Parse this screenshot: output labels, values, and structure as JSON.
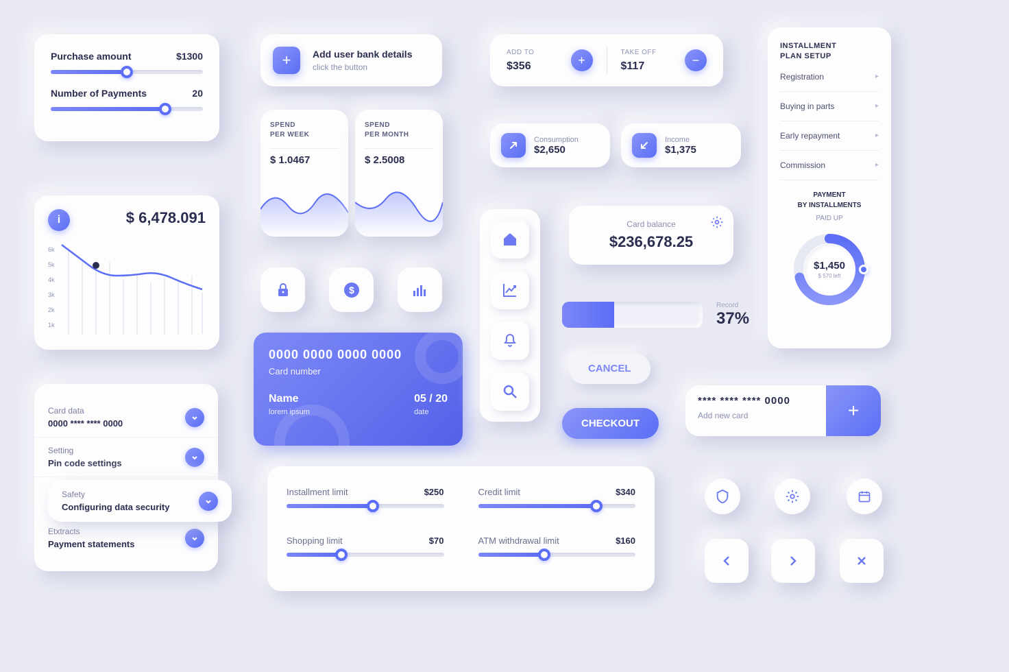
{
  "purchase": {
    "amount_label": "Purchase amount",
    "amount": "$1300",
    "payments_label": "Number of Payments",
    "payments": "20"
  },
  "bank": {
    "title": "Add user bank details",
    "subtitle": "click the button"
  },
  "addtake": {
    "add_label": "ADD TO",
    "add_value": "$356",
    "take_label": "TAKE OFF",
    "take_value": "$117"
  },
  "spend_week": {
    "label": "SPEND\nPER WEEK",
    "value": "$ 1.0467"
  },
  "spend_month": {
    "label": "SPEND\nPER MONTH",
    "value": "$ 2.5008"
  },
  "consumption": {
    "label": "Consumption",
    "value": "$2,650"
  },
  "income": {
    "label": "Income",
    "value": "$1,375"
  },
  "balance_chart": {
    "amount": "$ 6,478.091"
  },
  "card_balance": {
    "label": "Card balance",
    "value": "$236,678.25"
  },
  "progress": {
    "record_label": "Record",
    "record_value": "37%"
  },
  "buttons": {
    "cancel": "CANCEL",
    "checkout": "CHECKOUT"
  },
  "newcard": {
    "number": "**** **** **** 0000",
    "label": "Add new card"
  },
  "credit": {
    "number": "0000 0000 0000 0000",
    "number_label": "Card number",
    "name_label": "Name",
    "name_value": "lorem ipsum",
    "date_label": "date",
    "date_value": "05 / 20"
  },
  "settings": [
    {
      "title": "Card data",
      "value": "0000 **** **** 0000"
    },
    {
      "title": "Setting",
      "value": "Pin code settings"
    },
    {
      "title": "Safety",
      "value": "Configuring data security"
    },
    {
      "title": "Etxtracts",
      "value": "Payment statements"
    }
  ],
  "limits": {
    "installment": {
      "label": "Installment limit",
      "value": "$250"
    },
    "credit": {
      "label": "Credit limit",
      "value": "$340"
    },
    "shopping": {
      "label": "Shopping limit",
      "value": "$70"
    },
    "atm": {
      "label": "ATM withdrawal limit",
      "value": "$160"
    }
  },
  "installment": {
    "title": "INSTALLMENT\nPLAN SETUP",
    "items": [
      "Registration",
      "Buying in parts",
      "Early repayment",
      "Commission"
    ],
    "pay_title": "PAYMENT\nBY INSTALLMENTS",
    "paid": "PAID UP",
    "donut_value": "$1,450",
    "donut_sub": "$ 570 left"
  },
  "chart_data": {
    "type": "line",
    "title": "$ 6,478.091",
    "ylim": [
      0,
      6000
    ],
    "yticks": [
      "1k",
      "2k",
      "3k",
      "4k",
      "5k",
      "6k"
    ],
    "values": [
      6000,
      5200,
      4800,
      5000,
      3600,
      4000,
      3400,
      3800,
      3500,
      3900,
      3600,
      2800
    ]
  }
}
